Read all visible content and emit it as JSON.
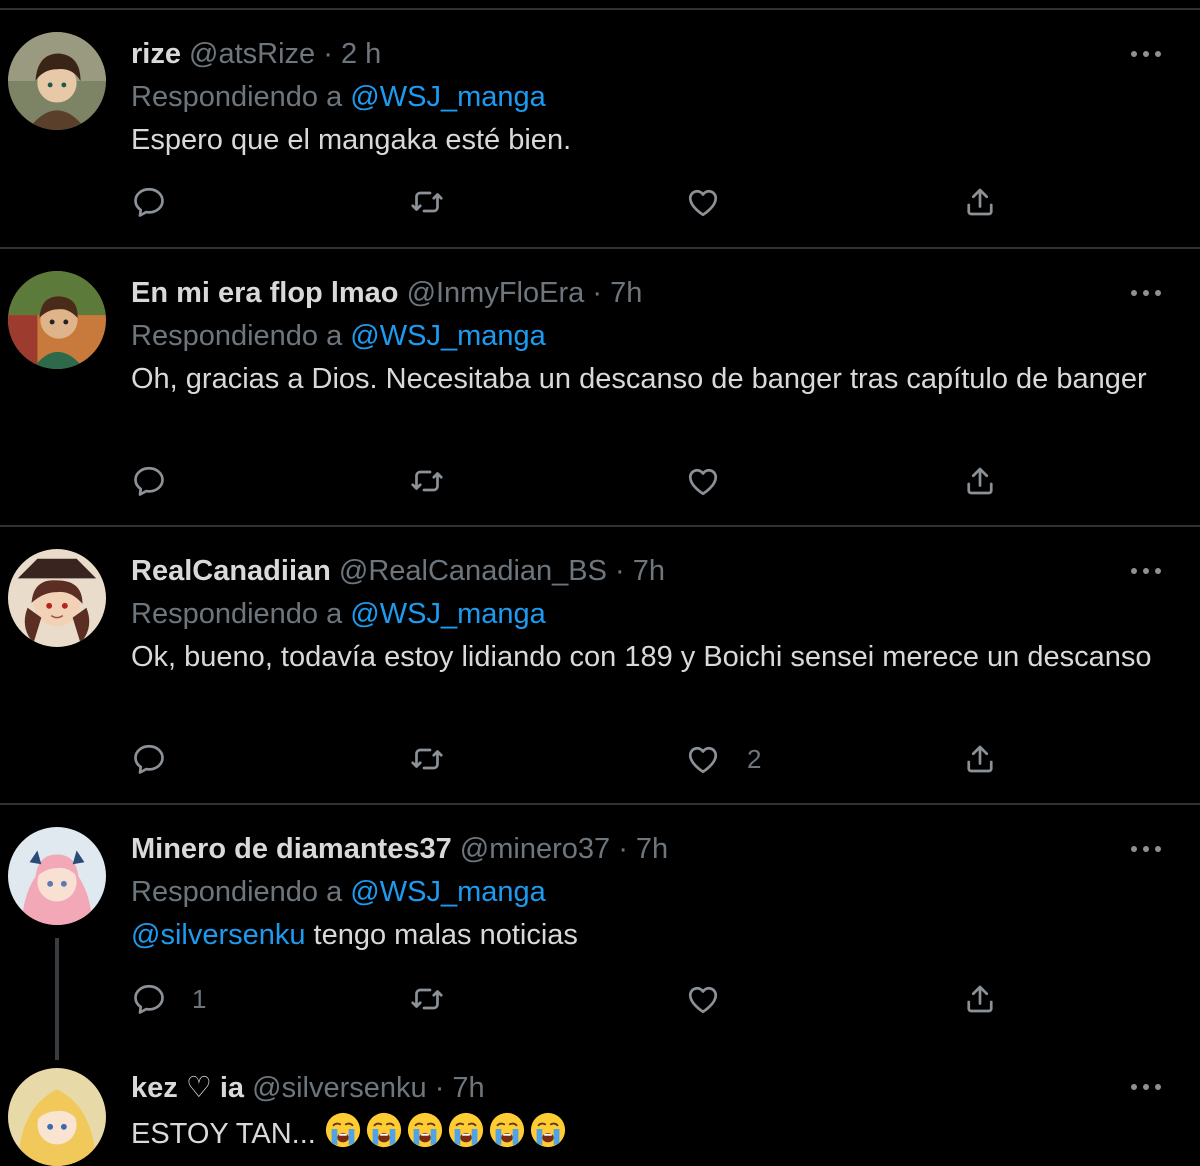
{
  "tweets": [
    {
      "name": "rize",
      "handle": "@atsRize",
      "time": "2 h",
      "replying_prefix": "Respondiendo a",
      "replying_to": "@WSJ_manga",
      "text": "Espero que el mangaka esté bien.",
      "reply_count": "",
      "like_count": ""
    },
    {
      "name": "En mi era flop lmao",
      "handle": "@InmyFloEra",
      "time": "7h",
      "replying_prefix": "Respondiendo a",
      "replying_to": "@WSJ_manga",
      "text": "Oh, gracias a Dios. Necesitaba un descanso de banger tras capítulo de banger",
      "reply_count": "",
      "like_count": ""
    },
    {
      "name": "RealCanadiian",
      "handle": "@RealCanadian_BS",
      "time": "7h",
      "replying_prefix": "Respondiendo a",
      "replying_to": "@WSJ_manga",
      "text": "Ok, bueno, todavía estoy lidiando con 189 y Boichi sensei merece un descanso",
      "reply_count": "",
      "like_count": "2"
    },
    {
      "name": "Minero de diamantes37",
      "handle": "@minero37",
      "time": "7h",
      "replying_prefix": "Respondiendo a",
      "replying_to": "@WSJ_manga",
      "text_mention": "@silversenku",
      "text": " tengo malas noticias",
      "reply_count": "1",
      "like_count": ""
    },
    {
      "name": "kez ♡ ia",
      "handle": "@silversenku",
      "time": "7h",
      "text": "ESTOY TAN...",
      "emoji_count": 6
    }
  ],
  "separator": "·",
  "icons": {
    "reply": "reply-icon",
    "retweet": "retweet-icon",
    "like": "heart-icon",
    "share": "share-icon",
    "more": "more-icon",
    "emoji": "crying-face-emoji"
  },
  "colors": {
    "background": "#000000",
    "text": "#d9d9d9",
    "muted": "#6e767d",
    "link": "#1d9bf0",
    "divider": "#2f3336"
  }
}
